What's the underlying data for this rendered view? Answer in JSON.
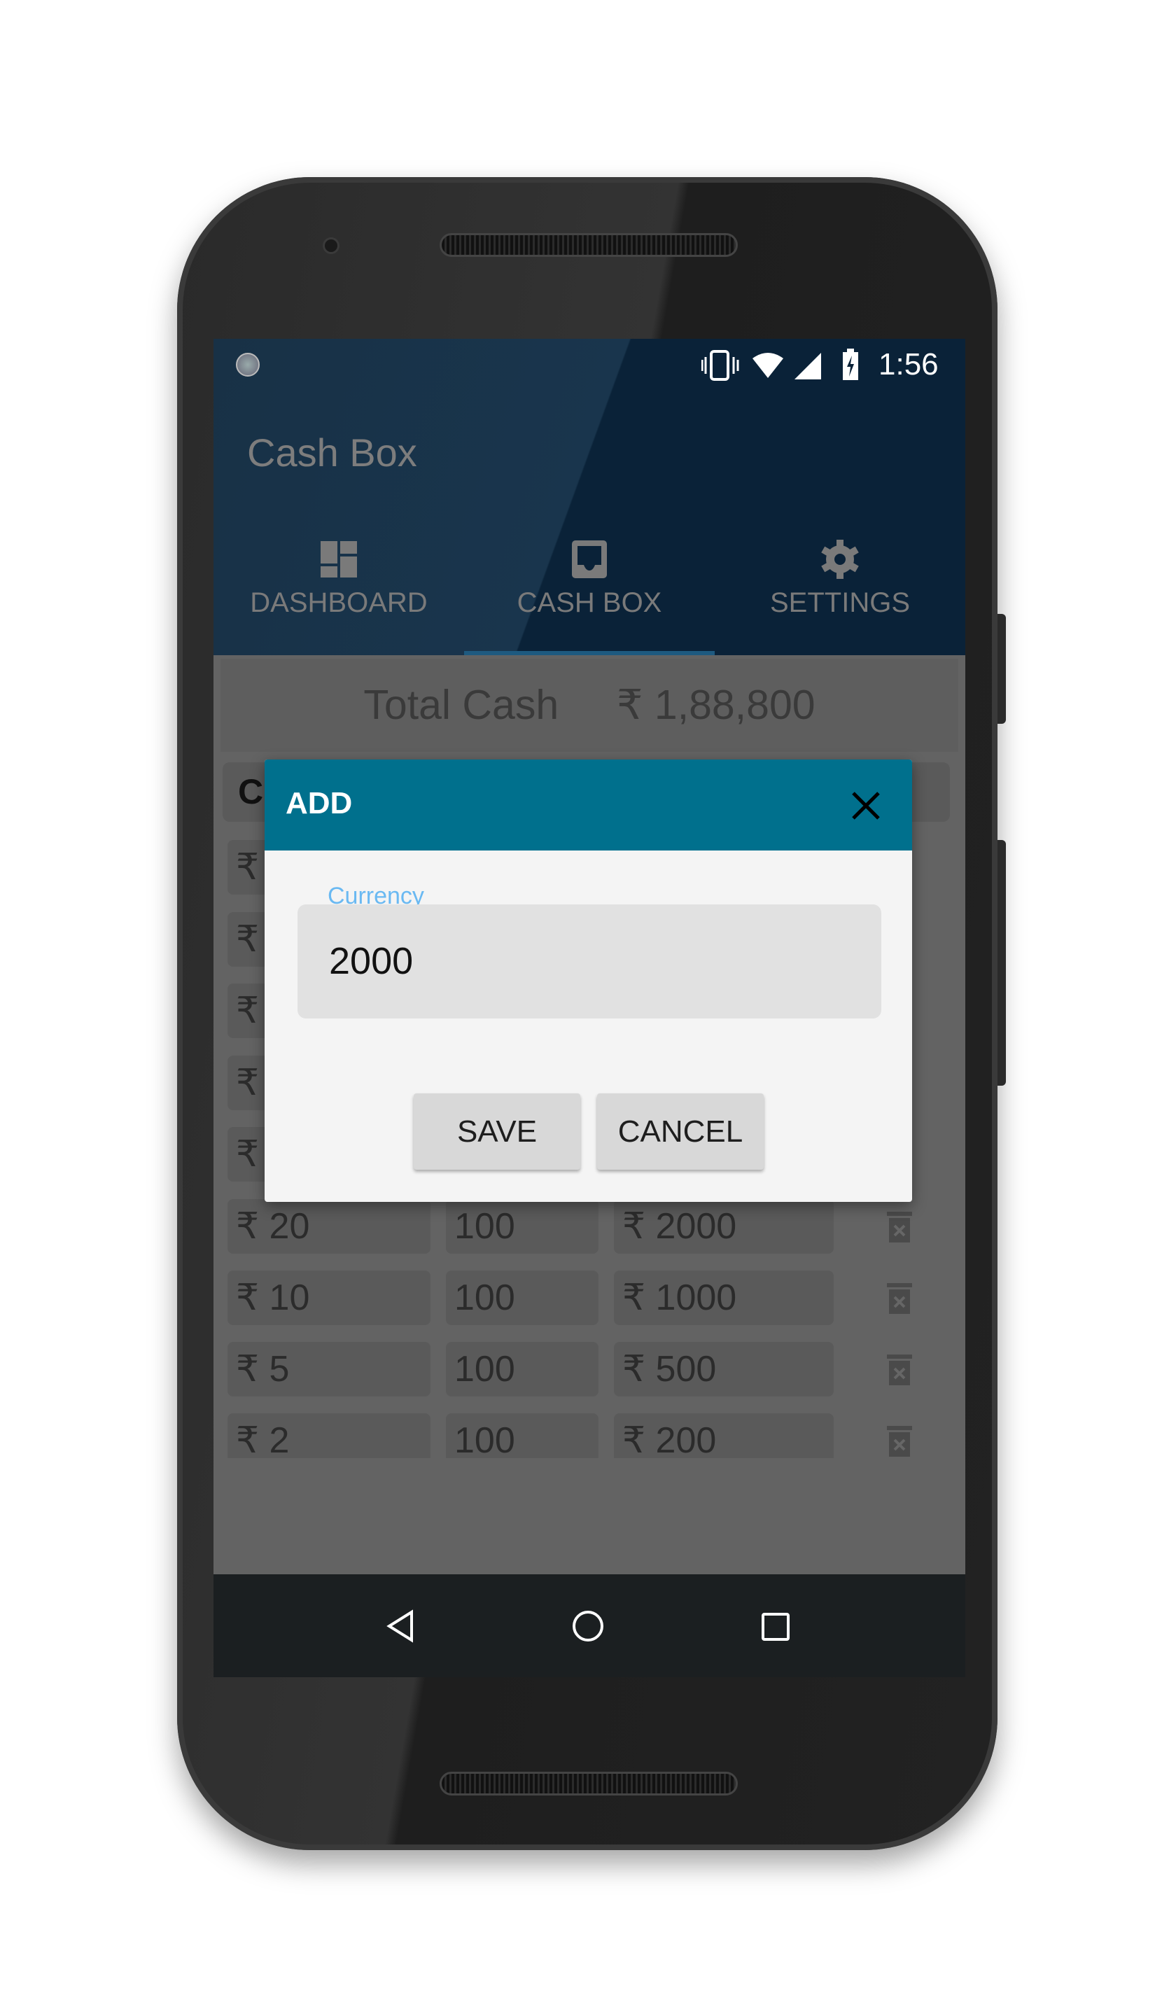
{
  "status_bar": {
    "time": "1:56",
    "icons": [
      "notification-dot-icon",
      "vibrate-icon",
      "wifi-icon",
      "signal-icon",
      "battery-charging-icon"
    ]
  },
  "app": {
    "title": "Cash Box"
  },
  "tabs": [
    {
      "label": "DASHBOARD",
      "icon": "dashboard-icon"
    },
    {
      "label": "CASH BOX",
      "icon": "inbox-icon",
      "selected": true
    },
    {
      "label": "SETTINGS",
      "icon": "gear-icon"
    }
  ],
  "summary": {
    "label": "Total Cash",
    "value": "₹ 1,88,800"
  },
  "table": {
    "header_partial": "Cu",
    "hidden_row_symbol": "₹",
    "rows": [
      {
        "currency": "₹ 20",
        "count": "100",
        "total": "₹ 2000"
      },
      {
        "currency": "₹ 10",
        "count": "100",
        "total": "₹ 1000"
      },
      {
        "currency": "₹ 5",
        "count": "100",
        "total": "₹ 500"
      },
      {
        "currency": "₹ 2",
        "count": "100",
        "total": "₹ 200"
      }
    ]
  },
  "dialog": {
    "title": "ADD",
    "field_label": "Currency",
    "field_value": "2000",
    "save_label": "SAVE",
    "cancel_label": "CANCEL"
  },
  "colors": {
    "dialog_header": "#00708d",
    "field_label": "#6ab9f2",
    "app_bar": "#0a2238",
    "tab_indicator": "#1e5a80"
  },
  "nav": {
    "icons": [
      "back-icon",
      "home-icon",
      "recents-icon"
    ]
  }
}
